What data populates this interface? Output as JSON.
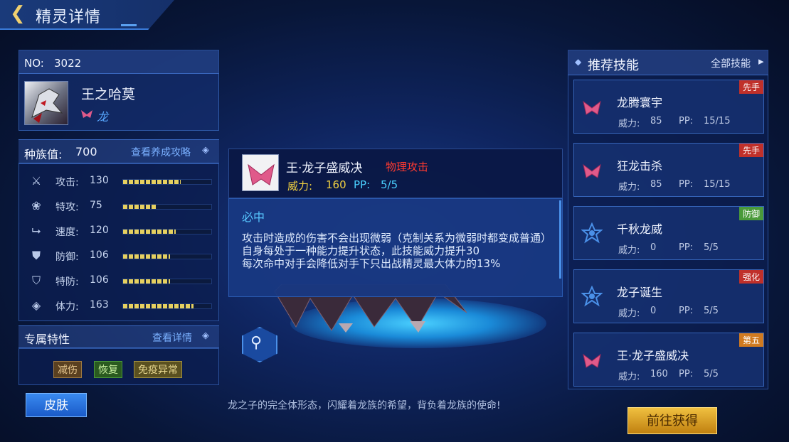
{
  "header": {
    "title": "精灵详情"
  },
  "pet": {
    "no_label": "NO:",
    "no_value": "3022",
    "name": "王之哈莫",
    "type": "龙"
  },
  "race": {
    "label": "种族值:",
    "value": "700",
    "guide_link": "查看养成攻略"
  },
  "stats": [
    {
      "icon": "sword-icon",
      "label": "攻击:",
      "value": "130",
      "fill": 0.65
    },
    {
      "icon": "magic-icon",
      "label": "特攻:",
      "value": "75",
      "fill": 0.38
    },
    {
      "icon": "boot-icon",
      "label": "速度:",
      "value": "120",
      "fill": 0.6
    },
    {
      "icon": "shield-icon",
      "label": "防御:",
      "value": "106",
      "fill": 0.53
    },
    {
      "icon": "special-shield-icon",
      "label": "特防:",
      "value": "106",
      "fill": 0.53
    },
    {
      "icon": "capsule-icon",
      "label": "体力:",
      "value": "163",
      "fill": 0.8
    }
  ],
  "traits": {
    "title": "专属特性",
    "detail_link": "查看详情",
    "tags": [
      "减伤",
      "恢复",
      "免疫异常"
    ]
  },
  "skin_button": "皮肤",
  "popup": {
    "name": "王·龙子盛威决",
    "category": "物理攻击",
    "power_label": "威力:",
    "power": "160",
    "pp_label": "PP:",
    "pp": "5/5",
    "effect_title": "必中",
    "desc": [
      "攻击时造成的伤害不会出现微弱（克制关系为微弱时都变成普通）",
      "自身每处于一种能力提升状态，此技能威力提升30",
      "每次命中对手会降低对手下只出战精灵最大体力的13%"
    ]
  },
  "flavor": "龙之子的完全体形态，闪耀着龙族的希望，背负着龙族的使命!",
  "right": {
    "title": "推荐技能",
    "all_link": "全部技能",
    "skills": [
      {
        "icon": "dragon-wing-icon",
        "name": "龙腾寰宇",
        "power_label": "威力:",
        "power": "85",
        "pp_label": "PP:",
        "pp": "15/15",
        "badge": "先手",
        "badge_color": "#c0302a"
      },
      {
        "icon": "dragon-wing-icon",
        "name": "狂龙击杀",
        "power_label": "威力:",
        "power": "85",
        "pp_label": "PP:",
        "pp": "15/15",
        "badge": "先手",
        "badge_color": "#c0302a"
      },
      {
        "icon": "star-icon",
        "name": "千秋龙威",
        "power_label": "威力:",
        "power": "0",
        "pp_label": "PP:",
        "pp": "5/5",
        "badge": "防御",
        "badge_color": "#4a9a3a"
      },
      {
        "icon": "star-icon",
        "name": "龙子诞生",
        "power_label": "威力:",
        "power": "0",
        "pp_label": "PP:",
        "pp": "5/5",
        "badge": "强化",
        "badge_color": "#c0302a"
      },
      {
        "icon": "dragon-wing-icon",
        "name": "王·龙子盛威决",
        "power_label": "威力:",
        "power": "160",
        "pp_label": "PP:",
        "pp": "5/5",
        "badge": "第五",
        "badge_color": "#d07a20"
      }
    ]
  },
  "obtain_button": "前往获得"
}
